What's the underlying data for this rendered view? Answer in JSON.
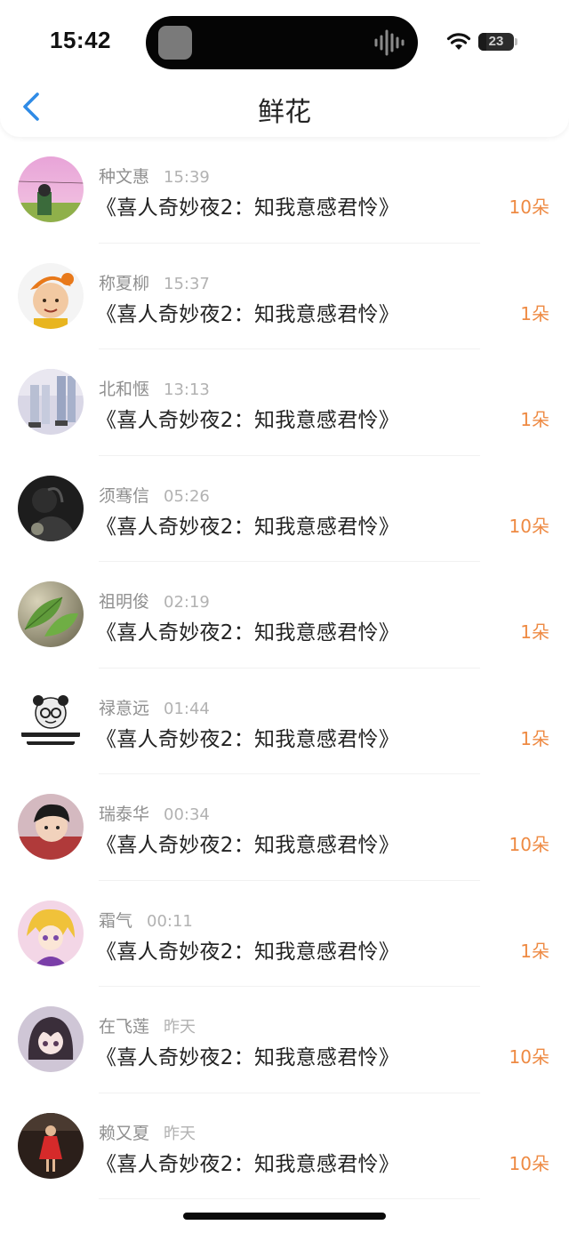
{
  "status": {
    "time": "15:42",
    "battery": "23",
    "battery_level": 0.23
  },
  "nav": {
    "title": "鲜花",
    "back_icon": "chevron-left-icon",
    "accent": "#2f8be6"
  },
  "colors": {
    "count": "#ee8a43"
  },
  "records": [
    {
      "name": "种文惠",
      "time": "15:39",
      "title": "《喜人奇妙夜2：知我意感君怜》",
      "count": "10朵",
      "avatar": "pink-sky-figure"
    },
    {
      "name": "称夏柳",
      "time": "15:37",
      "title": "《喜人奇妙夜2：知我意感君怜》",
      "count": "1朵",
      "avatar": "child-orange-hat"
    },
    {
      "name": "北和惬",
      "time": "13:13",
      "title": "《喜人奇妙夜2：知我意感君怜》",
      "count": "1朵",
      "avatar": "couple-legs"
    },
    {
      "name": "须骞信",
      "time": "05:26",
      "title": "《喜人奇妙夜2：知我意感君怜》",
      "count": "10朵",
      "avatar": "dark-portrait"
    },
    {
      "name": "祖明俊",
      "time": "02:19",
      "title": "《喜人奇妙夜2：知我意感君怜》",
      "count": "1朵",
      "avatar": "green-leaf"
    },
    {
      "name": "禄意远",
      "time": "01:44",
      "title": "《喜人奇妙夜2：知我意感君怜》",
      "count": "1朵",
      "avatar": "panda-meme"
    },
    {
      "name": "瑞泰华",
      "time": "00:34",
      "title": "《喜人奇妙夜2：知我意感君怜》",
      "count": "10朵",
      "avatar": "boy-portrait"
    },
    {
      "name": "霜气",
      "time": "00:11",
      "title": "《喜人奇妙夜2：知我意感君怜》",
      "count": "1朵",
      "avatar": "anime-blonde"
    },
    {
      "name": "在飞莲",
      "time": "昨天",
      "title": "《喜人奇妙夜2：知我意感君怜》",
      "count": "10朵",
      "avatar": "anime-girl"
    },
    {
      "name": "赖又夏",
      "time": "昨天",
      "title": "《喜人奇妙夜2：知我意感君怜》",
      "count": "10朵",
      "avatar": "red-dress-figure"
    }
  ]
}
